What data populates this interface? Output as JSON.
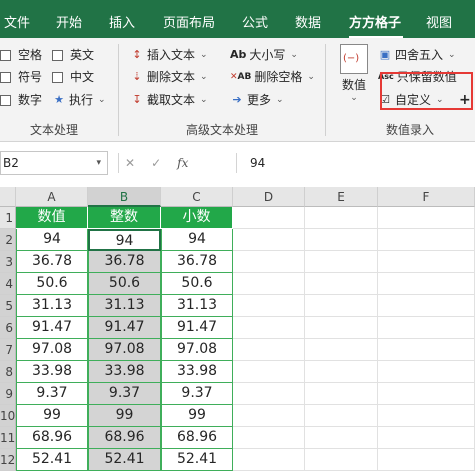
{
  "tabs": [
    "文件",
    "开始",
    "插入",
    "页面布局",
    "公式",
    "数据",
    "方方格子",
    "视图"
  ],
  "active_tab": "方方格子",
  "text_processing": {
    "checks": [
      "空格",
      "英文",
      "符号",
      "中文",
      "数字"
    ],
    "execute_label": "执行",
    "group_label": "文本处理"
  },
  "advanced_text": {
    "insert_text": "插入文本",
    "delete_text": "删除文本",
    "extract_text": "截取文本",
    "case_label": "大小写",
    "case_icon": "Ab",
    "delete_spaces": "删除空格",
    "delete_spaces_icon": "AB",
    "more_label": "更多",
    "group_label": "高级文本处理"
  },
  "number_entry": {
    "number_button": "数值",
    "round_label": "四舍五入",
    "keep_value_label": "只保留数值",
    "keep_value_icon": "Asc",
    "custom_label": "自定义",
    "add_label": "+",
    "group_label": "数值录入"
  },
  "formula_bar": {
    "name_box": "B2",
    "cancel": "✕",
    "confirm": "✓",
    "fx": "fx",
    "value": "94"
  },
  "columns": [
    "A",
    "B",
    "C",
    "D",
    "E",
    "F"
  ],
  "rows": [
    "1",
    "2",
    "3",
    "4",
    "5",
    "6",
    "7",
    "8",
    "9",
    "10",
    "11",
    "12"
  ],
  "table": {
    "headers": [
      "数值",
      "整数",
      "小数"
    ],
    "data": [
      [
        "94",
        "94",
        "94"
      ],
      [
        "36.78",
        "36.78",
        "36.78"
      ],
      [
        "50.6",
        "50.6",
        "50.6"
      ],
      [
        "31.13",
        "31.13",
        "31.13"
      ],
      [
        "91.47",
        "91.47",
        "91.47"
      ],
      [
        "97.08",
        "97.08",
        "97.08"
      ],
      [
        "33.98",
        "33.98",
        "33.98"
      ],
      [
        "9.37",
        "9.37",
        "9.37"
      ],
      [
        "99",
        "99",
        "99"
      ],
      [
        "68.96",
        "68.96",
        "68.96"
      ],
      [
        "52.41",
        "52.41",
        "52.41"
      ]
    ]
  },
  "colors": {
    "tab_bar": "#217346",
    "header_fill": "#22a849",
    "highlight": "#e53935"
  }
}
